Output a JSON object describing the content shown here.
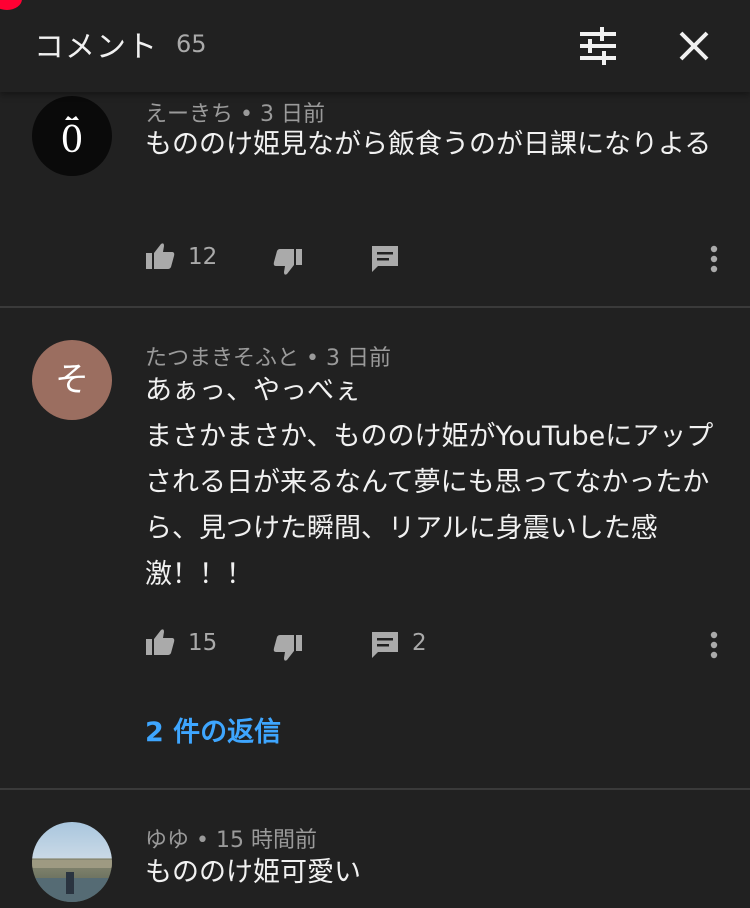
{
  "header": {
    "title": "コメント",
    "count": "65",
    "filter_icon": "tune-icon",
    "close_icon": "close-icon"
  },
  "colors": {
    "background": "#212121",
    "text": "#f1f1f1",
    "meta": "#9a9a9a",
    "link": "#3ea6ff",
    "divider": "#3a3a3a"
  },
  "comments": [
    {
      "author": "えーきち",
      "time": "3 日前",
      "meta": "えーきち • 3 日前",
      "text": "もののけ姫見ながら飯食うのが日課になりよる",
      "likes": "12",
      "replies_count": "",
      "avatar_letter": "0"
    },
    {
      "author": "たつまきそふと",
      "time": "3 日前",
      "meta": "たつまきそふと • 3 日前",
      "text": "あぁっ、やっべぇ\nまさかまさか、もののけ姫がYouTubeにアップされる日が来るなんて夢にも思ってなかったから、見つけた瞬間、リアルに身震いした感激！！！",
      "likes": "15",
      "replies_count": "2",
      "avatar_letter": "そ",
      "replies_link": "2 件の返信"
    },
    {
      "author": "ゆゆ",
      "time": "15 時間前",
      "meta": "ゆゆ • 15 時間前",
      "text": "もののけ姫可愛い",
      "avatar_letter": ""
    }
  ]
}
